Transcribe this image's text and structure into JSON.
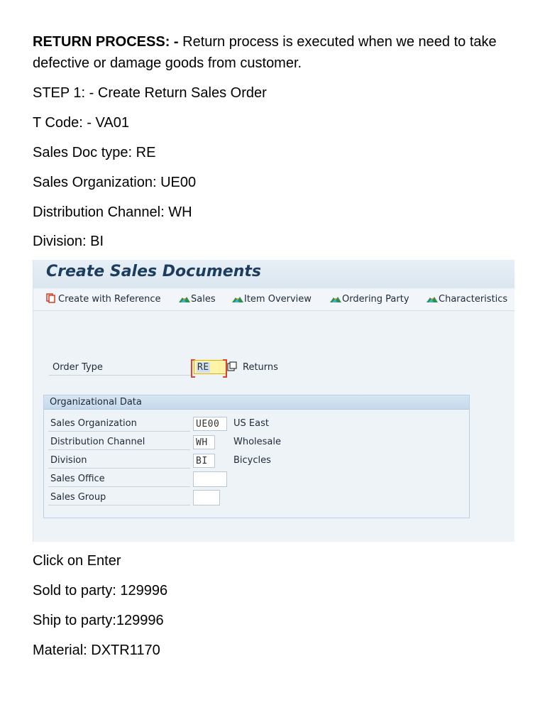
{
  "intro": {
    "heading": "RETURN PROCESS: -",
    "text": " Return process is executed when we need to take defective or damage goods from customer.",
    "lines": [
      "STEP 1: - Create Return Sales Order",
      "T Code: - VA01",
      "Sales Doc type: RE",
      "Sales Organization: UE00",
      "Distribution Channel: WH",
      "Division: BI"
    ]
  },
  "sap": {
    "title": "Create Sales Documents",
    "toolbar": [
      {
        "label": "Create with Reference",
        "icon": "copy-icon"
      },
      {
        "label": "Sales",
        "icon": "sales-icon"
      },
      {
        "label": "Item Overview",
        "icon": "item-overview-icon"
      },
      {
        "label": "Ordering Party",
        "icon": "ordering-party-icon"
      },
      {
        "label": "Characteristics",
        "icon": "characteristics-icon"
      }
    ],
    "order_type": {
      "label": "Order Type",
      "value": "RE",
      "description": "Returns"
    },
    "org": {
      "heading": "Organizational Data",
      "rows": [
        {
          "label": "Sales Organization",
          "value": "UE00",
          "description": "US East"
        },
        {
          "label": "Distribution Channel",
          "value": "WH",
          "description": "Wholesale"
        },
        {
          "label": "Division",
          "value": "BI",
          "description": "Bicycles"
        },
        {
          "label": "Sales Office",
          "value": "",
          "description": ""
        },
        {
          "label": "Sales Group",
          "value": "",
          "description": ""
        }
      ]
    },
    "colors": {
      "title": "#1d3d5f",
      "active_field": "#fff3a6",
      "required_bracket": "#e0412a"
    }
  },
  "steps": [
    "Click on Enter",
    "Sold to party: 129996",
    "Ship to party:129996",
    "Material: DXTR1170"
  ]
}
